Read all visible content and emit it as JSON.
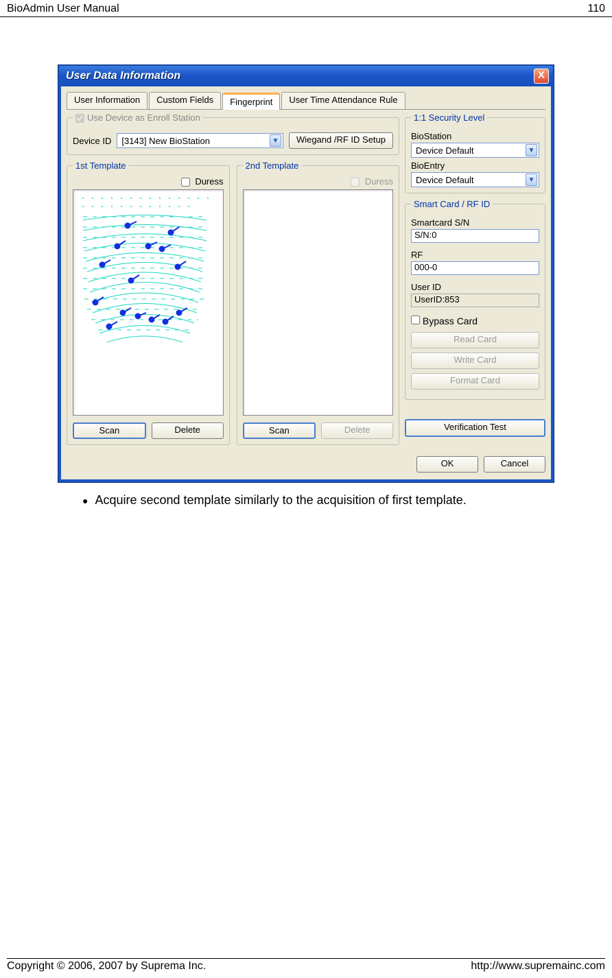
{
  "header": {
    "title": "BioAdmin User Manual",
    "page": "110"
  },
  "footer": {
    "copyright": "Copyright © 2006, 2007 by Suprema Inc.",
    "url": "http://www.supremainc.com"
  },
  "bullet": "Acquire second template similarly to the acquisition of first template.",
  "dialog": {
    "title": "User Data Information",
    "close": "X",
    "tabs": [
      "User Information",
      "Custom Fields",
      "Fingerprint",
      "User Time Attendance Rule"
    ],
    "activeTab": 2,
    "enroll": {
      "legend": "Use Device as Enroll Station",
      "deviceIdLabel": "Device ID",
      "deviceSelected": "[3143] New BioStation",
      "wiegandBtn": "Wiegand /RF ID Setup"
    },
    "t1": {
      "legend": "1st Template",
      "duress": "Duress",
      "scan": "Scan",
      "delete": "Delete"
    },
    "t2": {
      "legend": "2nd Template",
      "duress": "Duress",
      "scan": "Scan",
      "delete": "Delete"
    },
    "security": {
      "legend": "1:1 Security Level",
      "bioStationLabel": "BioStation",
      "bioStationVal": "Device Default",
      "bioEntryLabel": "BioEntry",
      "bioEntryVal": "Device Default"
    },
    "smartcard": {
      "legend": "Smart Card / RF ID",
      "snLabel": "Smartcard S/N",
      "snVal": "S/N:0",
      "rfLabel": "RF",
      "rfVal": "000-0",
      "userIdLabel": "User ID",
      "userIdVal": "UserID:853",
      "bypass": "Bypass Card",
      "readBtn": "Read Card",
      "writeBtn": "Write Card",
      "formatBtn": "Format Card"
    },
    "verifyBtn": "Verification Test",
    "ok": "OK",
    "cancel": "Cancel"
  }
}
